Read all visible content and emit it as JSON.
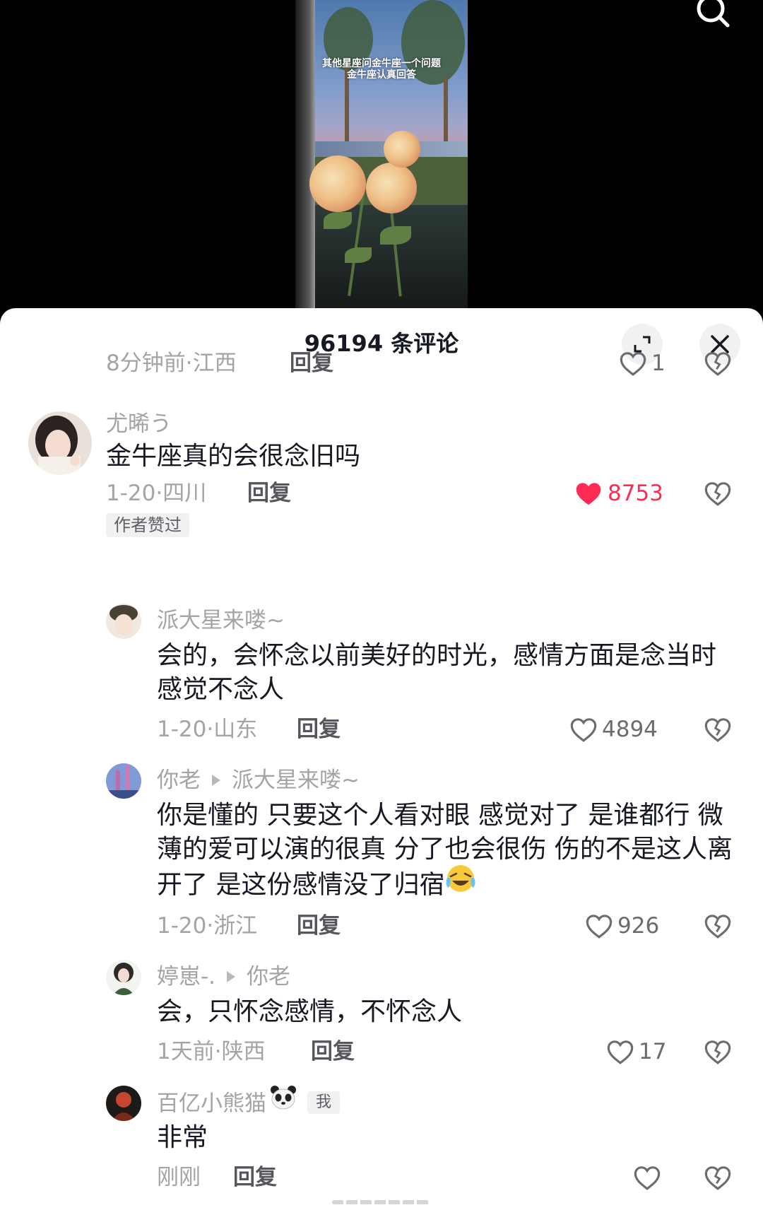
{
  "video": {
    "caption_line1": "其他星座问金牛座一个问题",
    "caption_line2": "金牛座认真回答"
  },
  "header_icons": {
    "search": "search-icon"
  },
  "panel": {
    "title": "96194 条评论",
    "expand_icon": "expand-icon",
    "close_icon": "close-icon"
  },
  "colors": {
    "liked": "#fe2c55",
    "meta": "#a3a4a8",
    "text": "#161823"
  },
  "comments": [
    {
      "time": "8分钟前",
      "location": "江西",
      "reply": "回复",
      "likes": "1",
      "liked": false
    },
    {
      "user": "尤晞う",
      "text": "金牛座真的会很念旧吗",
      "time": "1-20",
      "location": "四川",
      "reply": "回复",
      "likes": "8753",
      "liked": true,
      "badge": "作者赞过"
    },
    {
      "user": "派大星来喽~",
      "text": "会的，会怀念以前美好的时光，感情方面是念当时感觉不念人",
      "time": "1-20",
      "location": "山东",
      "reply": "回复",
      "likes": "4894",
      "liked": false
    },
    {
      "user": "你老",
      "reply_to": "派大星来喽~",
      "text": "你是懂的 只要这个人看对眼 感觉对了 是谁都行 微薄的爱可以演的很真 分了也会很伤 伤的不是这人离开了 是这份感情没了归宿",
      "time": "1-20",
      "location": "浙江",
      "reply": "回复",
      "likes": "926",
      "liked": false
    },
    {
      "user": "婷崽-.",
      "reply_to": "你老",
      "text": "会，只怀念感情，不怀念人",
      "time": "1天前",
      "location": "陕西",
      "reply": "回复",
      "likes": "17",
      "liked": false
    },
    {
      "user": "百亿小熊猫",
      "user_emoji": "panda-emoji",
      "me_badge": "我",
      "text": "非常",
      "time": "刚刚",
      "reply": "回复",
      "likes": "",
      "liked": false
    }
  ],
  "separator": "·"
}
